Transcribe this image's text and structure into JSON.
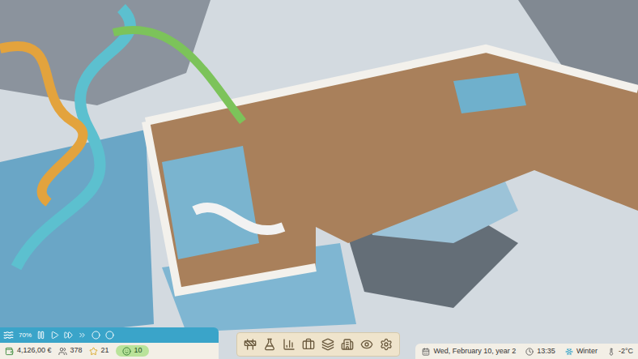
{
  "hud": {
    "zoom": "70%",
    "stats": {
      "money": "4,126,00 €",
      "visitors": "378",
      "rating": "21",
      "happiness": "10"
    },
    "date": "Wed, February 10, year 2",
    "time": "13:35",
    "season": "Winter",
    "temperature": "-2°C"
  }
}
